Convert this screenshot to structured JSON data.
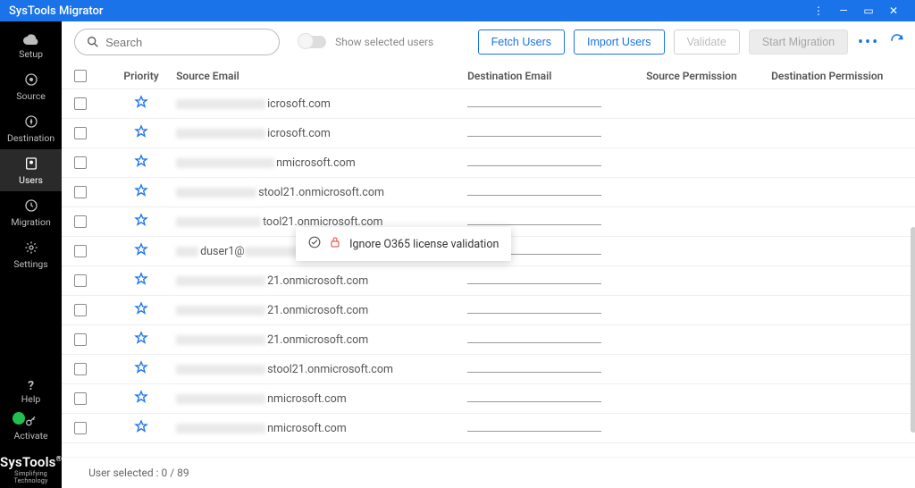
{
  "window": {
    "title": "SysTools Migrator"
  },
  "sidebar": {
    "items": [
      {
        "label": "Setup"
      },
      {
        "label": "Source"
      },
      {
        "label": "Destination"
      },
      {
        "label": "Users"
      },
      {
        "label": "Migration"
      },
      {
        "label": "Settings"
      }
    ],
    "help": {
      "label": "Help"
    },
    "activate": {
      "label": "Activate"
    },
    "brand": {
      "name": "SysTools",
      "tagline": "Simplifying Technology"
    }
  },
  "toolbar": {
    "search_placeholder": "Search",
    "toggle_label": "Show selected users",
    "fetch_label": "Fetch Users",
    "import_label": "Import Users",
    "validate_label": "Validate",
    "start_label": "Start Migration"
  },
  "columns": {
    "priority": "Priority",
    "source_email": "Source Email",
    "dest_email": "Destination Email",
    "source_perm": "Source Permission",
    "dest_perm": "Destination Permission"
  },
  "rows": [
    {
      "suffix": "icrosoft.com",
      "blur_w": 100
    },
    {
      "suffix": "icrosoft.com",
      "blur_w": 100
    },
    {
      "suffix": "nmicrosoft.com",
      "blur_w": 110
    },
    {
      "suffix": "stool21.onmicrosoft.com",
      "blur_w": 90
    },
    {
      "suffix": "tool21.onmicrosoft.com",
      "blur_w": 95
    },
    {
      "prefix_visible": "duser1@",
      "suffix": "",
      "blur_w": 25,
      "post_blur_w": 135
    },
    {
      "suffix": "21.onmicrosoft.com",
      "blur_w": 100
    },
    {
      "suffix": "21.onmicrosoft.com",
      "blur_w": 100
    },
    {
      "suffix": "21.onmicrosoft.com",
      "blur_w": 100
    },
    {
      "suffix": "stool21.onmicrosoft.com",
      "blur_w": 100
    },
    {
      "suffix": "nmicrosoft.com",
      "blur_w": 100
    },
    {
      "suffix": "nmicrosoft.com",
      "blur_w": 100
    }
  ],
  "tooltip": {
    "text": "Ignore O365 license validation"
  },
  "footer": {
    "selected_text": "User selected : 0 / 89"
  }
}
